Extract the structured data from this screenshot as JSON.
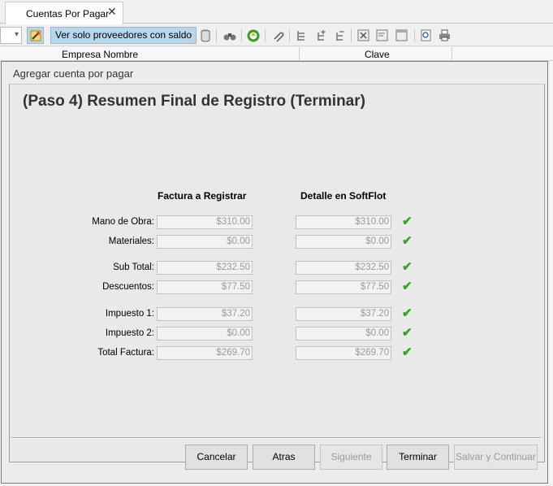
{
  "tab": {
    "label": "Cuentas Por Pagar",
    "close": "✕"
  },
  "toolbar": {
    "filter_label": "Ver solo proveedores con saldo",
    "icons": [
      "wand-icon",
      "database-icon",
      "binoculars-icon",
      "refresh-icon",
      "paperclip-icon",
      "tree-icon",
      "tree-add-icon",
      "tree-remove-icon",
      "excel-icon",
      "note-icon",
      "table-icon",
      "preview-icon",
      "print-icon"
    ]
  },
  "grid": {
    "columns": [
      "Empresa Nombre",
      "Clave"
    ]
  },
  "dialog": {
    "title": "Agregar cuenta por pagar",
    "step": "(Paso 4)  Resumen Final de Registro (Terminar)",
    "col_invoice": "Factura a Registrar",
    "col_system": "Detalle en SoftFlot",
    "rows": [
      {
        "label": "Mano de Obra:",
        "invoice": "$310.00",
        "system": "$310.00"
      },
      {
        "label": "Materiales:",
        "invoice": "$0.00",
        "system": "$0.00"
      },
      {
        "label": "Sub Total:",
        "invoice": "$232.50",
        "system": "$232.50"
      },
      {
        "label": "Descuentos:",
        "invoice": "$77.50",
        "system": "$77.50"
      },
      {
        "label": "Impuesto 1:",
        "invoice": "$37.20",
        "system": "$37.20"
      },
      {
        "label": "Impuesto 2:",
        "invoice": "$0.00",
        "system": "$0.00"
      },
      {
        "label": "Total Factura:",
        "invoice": "$269.70",
        "system": "$269.70"
      }
    ],
    "check": "✔",
    "buttons": {
      "cancel": "Cancelar",
      "back": "Atras",
      "next": "Siguiente",
      "finish": "Terminar",
      "save_continue": "Salvar y Continuar"
    }
  }
}
